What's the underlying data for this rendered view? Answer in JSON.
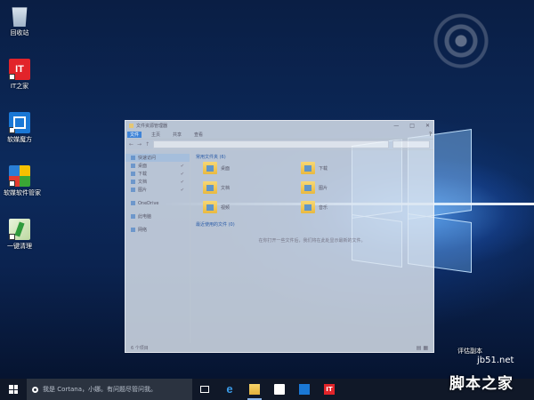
{
  "desktop": {
    "icons": [
      {
        "label": "回收站",
        "icon": "recycle-bin-icon"
      },
      {
        "label": "IT之家",
        "icon": "ithome-app-icon",
        "glyph": "IT"
      },
      {
        "label": "软媒魔方",
        "icon": "ruanmei-cube-icon"
      },
      {
        "label": "软媒软件管家",
        "icon": "software-manager-icon"
      },
      {
        "label": "一键清理",
        "icon": "one-click-clean-icon"
      }
    ],
    "activation_text": "评估副本",
    "watermark": {
      "site": "jb51.net",
      "brand": "脚本之家"
    }
  },
  "explorer": {
    "title": "文件资源管理器",
    "controls": {
      "minimize": "—",
      "maximize": "□",
      "close": "✕"
    },
    "ribbon_tabs": [
      "文件",
      "主页",
      "共享",
      "查看"
    ],
    "help": "?",
    "nav": {
      "quick_access": "快速访问",
      "pinned": [
        "桌面",
        "下载",
        "文档",
        "图片"
      ],
      "pin_glyph": "✔",
      "onedrive": "OneDrive",
      "this_pc": "此电脑",
      "network": "网络"
    },
    "groups": {
      "frequent": "常用文件夹 (6)",
      "recent": "最近使用的文件 (0)"
    },
    "folders": [
      "桌面",
      "下载",
      "文档",
      "图片",
      "视频",
      "音乐"
    ],
    "recent_empty": "在你打开一些文件后，我们将在此处显示最新的文件。",
    "status": "6 个项目"
  },
  "taskbar": {
    "search_placeholder": "有问题尽管问我",
    "cortana_text": "我是 Cortana，小娜。有问题尽管问我。"
  }
}
